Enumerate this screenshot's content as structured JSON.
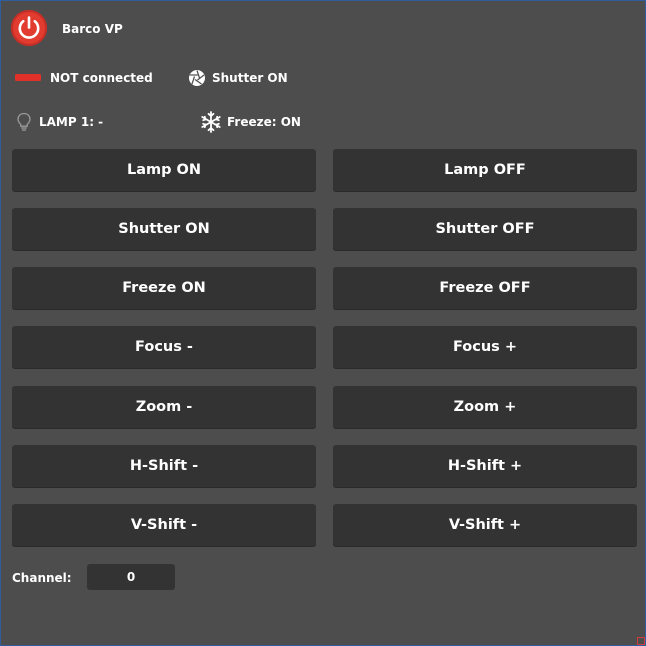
{
  "header": {
    "title": "Barco VP",
    "power_icon": "power-icon"
  },
  "status": {
    "connection_text": "NOT connected",
    "connection_color": "#e0302a",
    "shutter_text": "Shutter  ON",
    "lamp_text": "LAMP 1: -",
    "freeze_text": "Freeze: ON"
  },
  "buttons": {
    "lamp_on": "Lamp ON",
    "lamp_off": "Lamp OFF",
    "shutter_on": "Shutter ON",
    "shutter_off": "Shutter OFF",
    "freeze_on": "Freeze ON",
    "freeze_off": "Freeze OFF",
    "focus_minus": "Focus -",
    "focus_plus": "Focus +",
    "zoom_minus": "Zoom -",
    "zoom_plus": "Zoom +",
    "hshift_minus": "H-Shift -",
    "hshift_plus": "H-Shift +",
    "vshift_minus": "V-Shift -",
    "vshift_plus": "V-Shift +"
  },
  "channel": {
    "label": "Channel:",
    "value": "0"
  },
  "colors": {
    "background": "#4d4d4d",
    "button": "#333333",
    "accent": "#e23b30"
  }
}
